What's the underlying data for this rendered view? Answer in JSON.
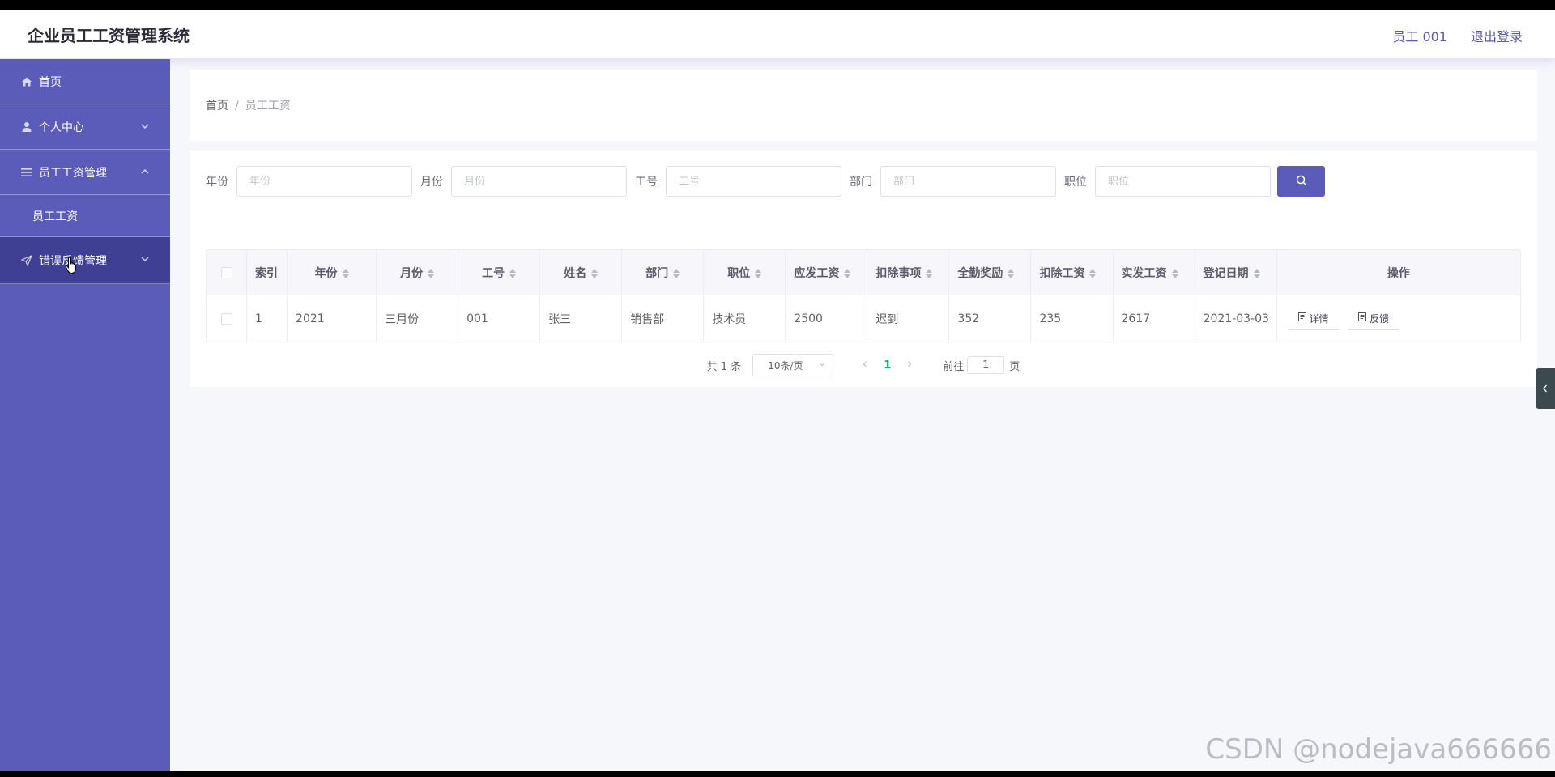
{
  "app": {
    "title": "企业员工工资管理系统",
    "user": "员工 001",
    "logout": "退出登录"
  },
  "sidebar": {
    "items": [
      {
        "label": "首页",
        "icon": "home-icon"
      },
      {
        "label": "个人中心",
        "icon": "user-icon"
      },
      {
        "label": "员工工资管理",
        "icon": "menu-icon"
      },
      {
        "label": "员工工资"
      },
      {
        "label": "错误反馈管理",
        "icon": "send-icon"
      }
    ]
  },
  "breadcrumb": {
    "home": "首页",
    "separator": "/",
    "current": "员工工资"
  },
  "search": {
    "fields": [
      {
        "label": "年份",
        "placeholder": "年份"
      },
      {
        "label": "月份",
        "placeholder": "月份"
      },
      {
        "label": "工号",
        "placeholder": "工号"
      },
      {
        "label": "部门",
        "placeholder": "部门"
      },
      {
        "label": "职位",
        "placeholder": "职位"
      }
    ]
  },
  "table": {
    "headers": [
      "索引",
      "年份",
      "月份",
      "工号",
      "姓名",
      "部门",
      "职位",
      "应发工资",
      "扣除事项",
      "全勤奖励",
      "扣除工资",
      "实发工资",
      "登记日期",
      "操作"
    ],
    "rows": [
      {
        "cells": [
          "1",
          "2021",
          "三月份",
          "001",
          "张三",
          "销售部",
          "技术员",
          "2500",
          "迟到",
          "352",
          "235",
          "2617",
          "2021-03-03"
        ],
        "actions": [
          "详情",
          "反馈"
        ]
      }
    ]
  },
  "pager": {
    "total": "共 1 条",
    "page_size": "10条/页",
    "current_page": "1",
    "goto_prefix": "前往",
    "goto_value": "1",
    "goto_suffix": "页"
  },
  "watermark": "CSDN @nodejava666666",
  "colors": {
    "sidebar": "#5b5bb9",
    "sidebar_hover": "#3f3f94",
    "accent": "#5b5bb9",
    "active_page": "#1aab8a"
  }
}
